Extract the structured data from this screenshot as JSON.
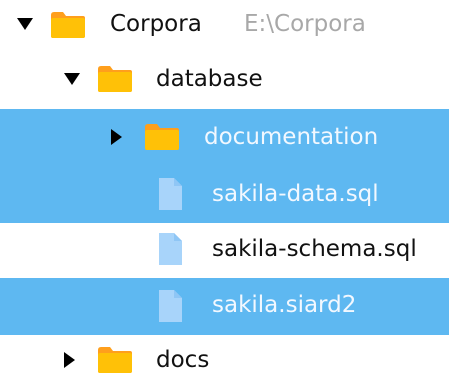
{
  "colors": {
    "selection": "#5eb8f1",
    "folder": "#ffc107",
    "folder_tab": "#ff9f1c",
    "file": "#a8d4fa",
    "path_text": "#a8a8a8"
  },
  "tree": {
    "root": {
      "label": "Corpora",
      "path": "E:\\Corpora",
      "expanded": true,
      "icon": "folder-icon"
    },
    "database": {
      "label": "database",
      "expanded": true,
      "icon": "folder-icon"
    },
    "documentation": {
      "label": "documentation",
      "expanded": false,
      "selected": true,
      "icon": "folder-icon"
    },
    "files": [
      {
        "label": "sakila-data.sql",
        "selected": true,
        "icon": "file-icon"
      },
      {
        "label": "sakila-schema.sql",
        "selected": false,
        "icon": "file-icon"
      },
      {
        "label": "sakila.siard2",
        "selected": true,
        "icon": "file-icon"
      }
    ],
    "docs": {
      "label": "docs",
      "expanded": false,
      "icon": "folder-icon"
    }
  }
}
